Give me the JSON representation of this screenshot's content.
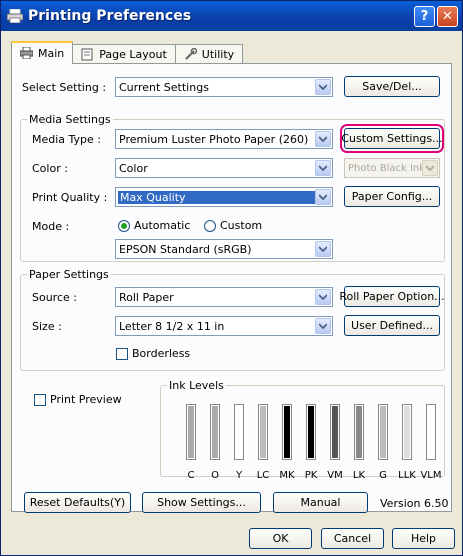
{
  "window": {
    "title": "Printing Preferences",
    "help": "?",
    "close": "✕"
  },
  "tabs": [
    {
      "label": "Main",
      "icon": "printer-icon"
    },
    {
      "label": "Page Layout",
      "icon": "page-icon"
    },
    {
      "label": "Utility",
      "icon": "wrench-icon"
    }
  ],
  "select_setting": {
    "label": "Select Setting :",
    "value": "Current Settings",
    "button": "Save/Del..."
  },
  "media": {
    "group": "Media Settings",
    "media_type_label": "Media Type :",
    "media_type_value": "Premium Luster Photo Paper (260)",
    "custom_settings_button": "Custom Settings...",
    "color_label": "Color :",
    "color_value": "Color",
    "black_ink_value": "Photo Black Ink",
    "print_quality_label": "Print Quality :",
    "print_quality_value": "Max Quality",
    "paper_config_button": "Paper Config...",
    "mode_label": "Mode :",
    "mode_automatic": "Automatic",
    "mode_custom": "Custom",
    "mode_selected": "Automatic",
    "color_mode_value": "EPSON Standard (sRGB)"
  },
  "paper": {
    "group": "Paper Settings",
    "source_label": "Source :",
    "source_value": "Roll Paper",
    "roll_option_button": "Roll Paper Option...",
    "size_label": "Size :",
    "size_value": "Letter 8 1/2 x 11 in",
    "user_defined_button": "User Defined...",
    "borderless_label": "Borderless",
    "borderless_checked": false
  },
  "preview": {
    "label": "Print Preview",
    "checked": false
  },
  "ink": {
    "group": "Ink Levels",
    "cartridges": [
      {
        "name": "C",
        "color": "#aaaaaa"
      },
      {
        "name": "O",
        "color": "#aaaaaa"
      },
      {
        "name": "Y",
        "color": "#ffffff"
      },
      {
        "name": "LC",
        "color": "#bbbbbb"
      },
      {
        "name": "MK",
        "color": "#000000"
      },
      {
        "name": "PK",
        "color": "#000000"
      },
      {
        "name": "VM",
        "color": "#555555"
      },
      {
        "name": "LK",
        "color": "#888888"
      },
      {
        "name": "G",
        "color": "#bbbbbb"
      },
      {
        "name": "LLK",
        "color": "#dddddd"
      },
      {
        "name": "VLM",
        "color": "#ffffff"
      }
    ]
  },
  "footer": {
    "reset_button": "Reset Defaults(Y)",
    "show_settings_button": "Show Settings...",
    "manual_button": "Manual",
    "version": "Version 6.50"
  },
  "dialog": {
    "ok": "OK",
    "cancel": "Cancel",
    "help": "Help"
  },
  "colors": {
    "titlebar": "#0a5fd8",
    "dialog_bg": "#ece9d8",
    "panel_bg": "#fcfcfe",
    "highlight": "#e2007a",
    "selection": "#316ac5"
  }
}
